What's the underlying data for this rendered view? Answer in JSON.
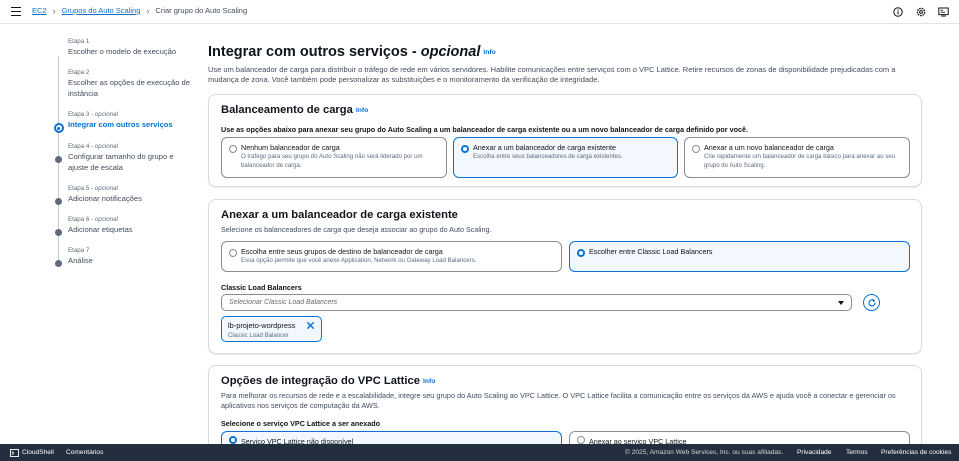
{
  "breadcrumb": {
    "items": [
      "EC2",
      "Grupos do Auto Scaling"
    ],
    "current": "Criar grupo do Auto Scaling"
  },
  "top_icons": [
    "info-icon",
    "settings-icon",
    "preferences-icon"
  ],
  "steps": [
    {
      "label": "Etapa 1",
      "optional": "",
      "title": "Escolher o modelo de execução",
      "state": "done"
    },
    {
      "label": "Etapa 2",
      "optional": "",
      "title": "Escolher as opções de execução de instância",
      "state": "done"
    },
    {
      "label": "Etapa 3 -",
      "optional": "opcional",
      "title": "Integrar com outros serviços",
      "state": "active"
    },
    {
      "label": "Etapa 4 -",
      "optional": "opcional",
      "title": "Configurar tamanho do grupo e ajuste de escala",
      "state": "pending"
    },
    {
      "label": "Etapa 5 -",
      "optional": "opcional",
      "title": "Adicionar notificações",
      "state": "pending"
    },
    {
      "label": "Etapa 6 -",
      "optional": "opcional",
      "title": "Adicionar etiquetas",
      "state": "pending"
    },
    {
      "label": "Etapa 7",
      "optional": "",
      "title": "Análise",
      "state": "pending"
    }
  ],
  "page": {
    "title": "Integrar com outros serviços -",
    "title_optional": "opcional",
    "info": "Info",
    "description": "Use um balanceador de carga para distribuir o tráfego de rede em vários servidores. Habilite comunicações entre serviços com o VPC Lattice. Retire recursos de zonas de disponibilidade prejudicadas com a mudança de zona. Você também pode personalizar as substituições e o monitoramento da verificação de integridade."
  },
  "load_balancing": {
    "title": "Balanceamento de carga",
    "info": "Info",
    "subtitle": "Use as opções abaixo para anexar seu grupo do Auto Scaling a um balanceador de carga existente ou a um novo balanceador de carga definido por você.",
    "options": [
      {
        "title": "Nenhum balanceador de carga",
        "desc": "O tráfego para seu grupo do Auto Scaling não será liderado por um balanceador de carga.",
        "selected": false
      },
      {
        "title": "Anexar a um balanceador de carga existente",
        "desc": "Escolha entre seus balanceadores de carga existentes.",
        "selected": true
      },
      {
        "title": "Anexar a um novo balanceador de carga",
        "desc": "Crie rapidamente um balanceador de carga básico para anexar ao seu grupo do Auto Scaling.",
        "selected": false
      }
    ]
  },
  "attach_existing": {
    "title": "Anexar a um balanceador de carga existente",
    "subtitle": "Selecione os balanceadores de carga que deseja associar ao grupo do Auto Scaling.",
    "options": [
      {
        "title": "Escolha entre seus grupos de destino de balanceador de carga",
        "desc": "Essa opção permite que você anexe Application, Network ou Gateway Load Balancers.",
        "selected": false
      },
      {
        "title": "Escolher entre Classic Load Balancers",
        "desc": "",
        "selected": true
      }
    ],
    "field_label": "Classic Load Balancers",
    "select_placeholder": "Selecionar Classic Load Balancers",
    "token": {
      "title": "lb-projeto-wordpress",
      "desc": "Classic Load Balancer"
    }
  },
  "vpc_lattice": {
    "title": "Opções de integração do VPC Lattice",
    "info": "Info",
    "description": "Para melhorar os recursos de rede e a escalabilidade, integre seu grupo do Auto Scaling ao VPC Lattice. O VPC Lattice facilita a comunicação entre os serviços da AWS e ajuda você a conectar e gerenciar os aplicativos nos serviços de computação da AWS.",
    "field_label": "Selecione o serviço VPC Lattice a ser anexado",
    "options": [
      {
        "title": "Serviço VPC Lattice não disponível",
        "selected": true
      },
      {
        "title": "Anexar ao serviço VPC Lattice",
        "selected": false
      }
    ]
  },
  "footer": {
    "cloudshell": "CloudShell",
    "comments": "Comentários",
    "copyright": "© 2025, Amazon Web Services, Inc. ou suas afiliadas.",
    "privacy": "Privacidade",
    "terms": "Termos",
    "cookies": "Preferências de cookies"
  },
  "colors": {
    "accent": "#0972d3",
    "footer_bg": "#232f3e",
    "selected_bg": "#f2f8fd"
  }
}
